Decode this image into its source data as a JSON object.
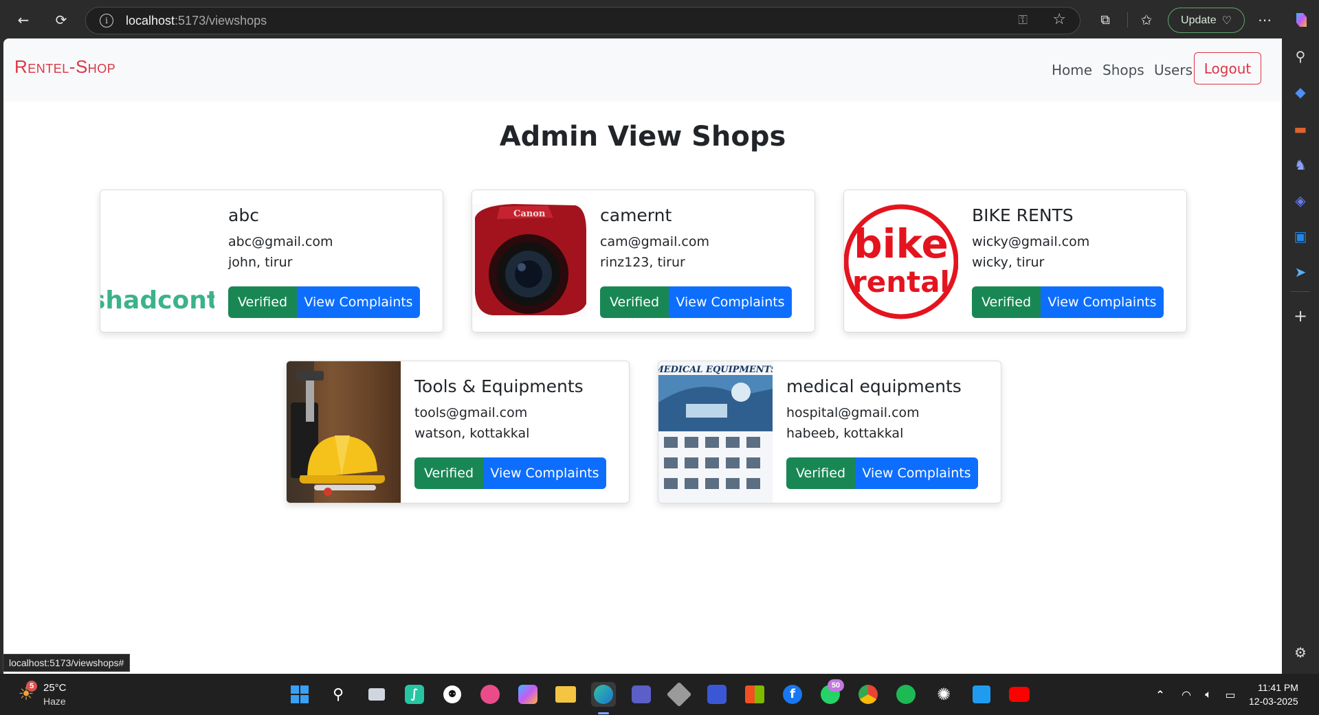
{
  "browser": {
    "url_host": "localhost",
    "url_path": ":5173/viewshops",
    "update_label": "Update"
  },
  "navbar": {
    "brand": "Rentel-Shop",
    "links": [
      "Home",
      "Shops",
      "Users"
    ],
    "logout_label": "Logout"
  },
  "page": {
    "title": "Admin View Shops"
  },
  "shops": [
    {
      "name": "abc",
      "email": "abc@gmail.com",
      "owner": "john, tirur",
      "image_text": "shadconta",
      "verified_label": "Verified",
      "complaints_label": "View Complaints"
    },
    {
      "name": "camernt",
      "email": "cam@gmail.com",
      "owner": "rinz123, tirur",
      "image_text": "Canon",
      "verified_label": "Verified",
      "complaints_label": "View Complaints"
    },
    {
      "name": "BIKE RENTS",
      "email": "wicky@gmail.com",
      "owner": "wicky, tirur",
      "image_text_1": "bike",
      "image_text_2": "rental",
      "verified_label": "Verified",
      "complaints_label": "View Complaints"
    },
    {
      "name": "Tools & Equipments",
      "email": "tools@gmail.com",
      "owner": "watson, kottakkal",
      "verified_label": "Verified",
      "complaints_label": "View Complaints"
    },
    {
      "name": "medical equipments",
      "email": "hospital@gmail.com",
      "owner": "habeeb, kottakkal",
      "image_text": "MEDICAL EQUIPMENTS",
      "verified_label": "Verified",
      "complaints_label": "View Complaints"
    }
  ],
  "status_bar": {
    "hover_url": "localhost:5173/viewshops#"
  },
  "taskbar": {
    "weather_temp": "25°C",
    "weather_cond": "Haze",
    "weather_badge": "5",
    "whatsapp_badge": "50",
    "time": "11:41 PM",
    "date": "12-03-2025"
  },
  "colors": {
    "brand": "#dc3545",
    "verified": "#198754",
    "complaints": "#0d6efd",
    "navbar_bg": "#f8f9fa"
  }
}
